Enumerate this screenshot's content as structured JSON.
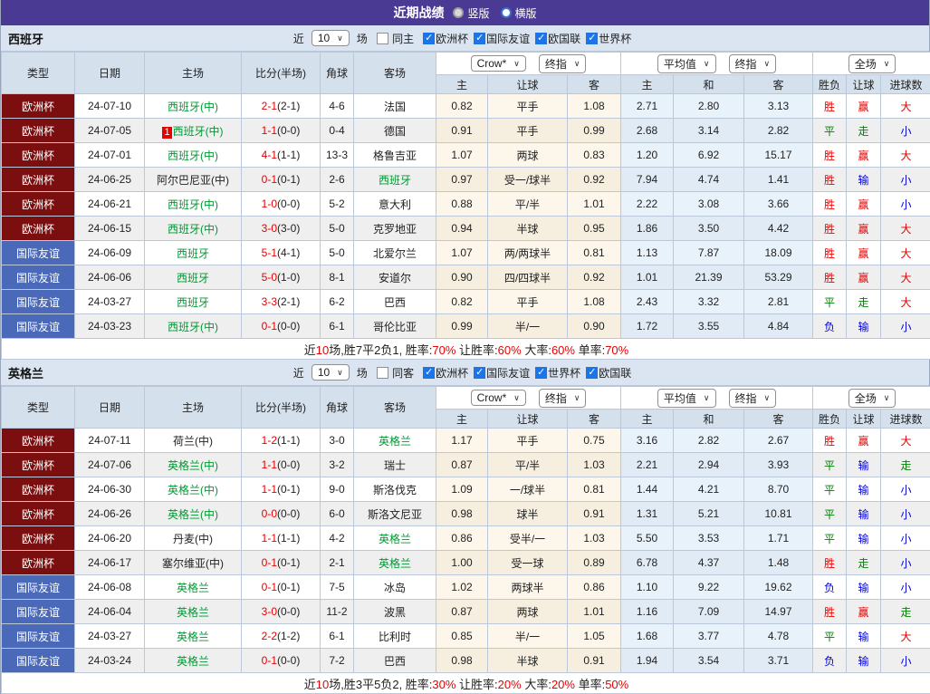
{
  "colors": {
    "topbar": "#4a3a94",
    "cup_type": "#7b0e0e",
    "friendly_type": "#4a69b8",
    "win_red": "#e60000",
    "team_green": "#009933",
    "lose_blue": "#0000dd",
    "header_bg": "#d5e0ed",
    "crow_col_bg": "#fdf6ea",
    "avg_col_bg": "#e8f2fb"
  },
  "topbar": {
    "title": "近期战绩",
    "radios": [
      {
        "label": "竖版",
        "selected": false
      },
      {
        "label": "横版",
        "selected": true
      }
    ]
  },
  "header": {
    "cols": [
      "类型",
      "日期",
      "主场",
      "比分(半场)",
      "角球",
      "客场"
    ],
    "group1": {
      "dd1": "Crow*",
      "dd2": "终指",
      "subs": [
        "主",
        "让球",
        "客"
      ]
    },
    "group2": {
      "dd1": "平均值",
      "dd2": "终指",
      "subs": [
        "主",
        "和",
        "客"
      ]
    },
    "group3": {
      "dd1": "全场",
      "subs": [
        "胜负",
        "让球",
        "进球数"
      ]
    }
  },
  "sections": [
    {
      "team": "西班牙",
      "filter": {
        "near": "近",
        "count": "10",
        "unit": "场",
        "same_label": "同主",
        "same_checked": false,
        "comps": [
          {
            "label": "欧洲杯",
            "checked": true
          },
          {
            "label": "国际友谊",
            "checked": true
          },
          {
            "label": "欧国联",
            "checked": true
          },
          {
            "label": "世界杯",
            "checked": true
          }
        ]
      },
      "rows": [
        {
          "type": "欧洲杯",
          "type_cls": "cup",
          "date": "24-07-10",
          "badge": "",
          "home": "西班牙(中)",
          "home_cls": "g",
          "score": "2-1",
          "half": "(2-1)",
          "corner": "4-6",
          "away": "法国",
          "away_cls": "k",
          "odds1": [
            "0.82",
            "平手",
            "1.08"
          ],
          "odds2": [
            "2.71",
            "2.80",
            "3.13"
          ],
          "res": [
            {
              "t": "胜",
              "c": "r"
            },
            {
              "t": "赢",
              "c": "r"
            },
            {
              "t": "大",
              "c": "r"
            }
          ]
        },
        {
          "type": "欧洲杯",
          "type_cls": "cup",
          "date": "24-07-05",
          "badge": "1",
          "home": "西班牙(中)",
          "home_cls": "g",
          "score": "1-1",
          "half": "(0-0)",
          "corner": "0-4",
          "away": "德国",
          "away_cls": "k",
          "odds1": [
            "0.91",
            "平手",
            "0.99"
          ],
          "odds2": [
            "2.68",
            "3.14",
            "2.82"
          ],
          "res": [
            {
              "t": "平",
              "c": "g"
            },
            {
              "t": "走",
              "c": "g"
            },
            {
              "t": "小",
              "c": "b"
            }
          ]
        },
        {
          "type": "欧洲杯",
          "type_cls": "cup",
          "date": "24-07-01",
          "badge": "",
          "home": "西班牙(中)",
          "home_cls": "g",
          "score": "4-1",
          "half": "(1-1)",
          "corner": "13-3",
          "away": "格鲁吉亚",
          "away_cls": "k",
          "odds1": [
            "1.07",
            "两球",
            "0.83"
          ],
          "odds2": [
            "1.20",
            "6.92",
            "15.17"
          ],
          "res": [
            {
              "t": "胜",
              "c": "r"
            },
            {
              "t": "赢",
              "c": "r"
            },
            {
              "t": "大",
              "c": "r"
            }
          ]
        },
        {
          "type": "欧洲杯",
          "type_cls": "cup",
          "date": "24-06-25",
          "badge": "",
          "home": "阿尔巴尼亚(中)",
          "home_cls": "k",
          "score": "0-1",
          "half": "(0-1)",
          "corner": "2-6",
          "away": "西班牙",
          "away_cls": "g",
          "odds1": [
            "0.97",
            "受一/球半",
            "0.92"
          ],
          "odds2": [
            "7.94",
            "4.74",
            "1.41"
          ],
          "res": [
            {
              "t": "胜",
              "c": "r"
            },
            {
              "t": "输",
              "c": "b"
            },
            {
              "t": "小",
              "c": "b"
            }
          ]
        },
        {
          "type": "欧洲杯",
          "type_cls": "cup",
          "date": "24-06-21",
          "badge": "",
          "home": "西班牙(中)",
          "home_cls": "g",
          "score": "1-0",
          "half": "(0-0)",
          "corner": "5-2",
          "away": "意大利",
          "away_cls": "k",
          "odds1": [
            "0.88",
            "平/半",
            "1.01"
          ],
          "odds2": [
            "2.22",
            "3.08",
            "3.66"
          ],
          "res": [
            {
              "t": "胜",
              "c": "r"
            },
            {
              "t": "赢",
              "c": "r"
            },
            {
              "t": "小",
              "c": "b"
            }
          ]
        },
        {
          "type": "欧洲杯",
          "type_cls": "cup",
          "date": "24-06-15",
          "badge": "",
          "home": "西班牙(中)",
          "home_cls": "g",
          "score": "3-0",
          "half": "(3-0)",
          "corner": "5-0",
          "away": "克罗地亚",
          "away_cls": "k",
          "odds1": [
            "0.94",
            "半球",
            "0.95"
          ],
          "odds2": [
            "1.86",
            "3.50",
            "4.42"
          ],
          "res": [
            {
              "t": "胜",
              "c": "r"
            },
            {
              "t": "赢",
              "c": "r"
            },
            {
              "t": "大",
              "c": "r"
            }
          ]
        },
        {
          "type": "国际友谊",
          "type_cls": "friendly",
          "date": "24-06-09",
          "badge": "",
          "home": "西班牙",
          "home_cls": "g",
          "score": "5-1",
          "half": "(4-1)",
          "corner": "5-0",
          "away": "北爱尔兰",
          "away_cls": "k",
          "odds1": [
            "1.07",
            "两/两球半",
            "0.81"
          ],
          "odds2": [
            "1.13",
            "7.87",
            "18.09"
          ],
          "res": [
            {
              "t": "胜",
              "c": "r"
            },
            {
              "t": "赢",
              "c": "r"
            },
            {
              "t": "大",
              "c": "r"
            }
          ]
        },
        {
          "type": "国际友谊",
          "type_cls": "friendly",
          "date": "24-06-06",
          "badge": "",
          "home": "西班牙",
          "home_cls": "g",
          "score": "5-0",
          "half": "(1-0)",
          "corner": "8-1",
          "away": "安道尔",
          "away_cls": "k",
          "odds1": [
            "0.90",
            "四/四球半",
            "0.92"
          ],
          "odds2": [
            "1.01",
            "21.39",
            "53.29"
          ],
          "res": [
            {
              "t": "胜",
              "c": "r"
            },
            {
              "t": "赢",
              "c": "r"
            },
            {
              "t": "大",
              "c": "r"
            }
          ]
        },
        {
          "type": "国际友谊",
          "type_cls": "friendly",
          "date": "24-03-27",
          "badge": "",
          "home": "西班牙",
          "home_cls": "g",
          "score": "3-3",
          "half": "(2-1)",
          "corner": "6-2",
          "away": "巴西",
          "away_cls": "k",
          "odds1": [
            "0.82",
            "平手",
            "1.08"
          ],
          "odds2": [
            "2.43",
            "3.32",
            "2.81"
          ],
          "res": [
            {
              "t": "平",
              "c": "g"
            },
            {
              "t": "走",
              "c": "g"
            },
            {
              "t": "大",
              "c": "r"
            }
          ]
        },
        {
          "type": "国际友谊",
          "type_cls": "friendly",
          "date": "24-03-23",
          "badge": "",
          "home": "西班牙(中)",
          "home_cls": "g",
          "score": "0-1",
          "half": "(0-0)",
          "corner": "6-1",
          "away": "哥伦比亚",
          "away_cls": "k",
          "odds1": [
            "0.99",
            "半/一",
            "0.90"
          ],
          "odds2": [
            "1.72",
            "3.55",
            "4.84"
          ],
          "res": [
            {
              "t": "负",
              "c": "b"
            },
            {
              "t": "输",
              "c": "b"
            },
            {
              "t": "小",
              "c": "b"
            }
          ]
        }
      ],
      "summary": [
        {
          "t": "近",
          "c": "k"
        },
        {
          "t": "10",
          "c": "r"
        },
        {
          "t": "场,胜7平2负1, 胜率:",
          "c": "k"
        },
        {
          "t": "70%",
          "c": "r"
        },
        {
          "t": " 让胜率:",
          "c": "k"
        },
        {
          "t": "60%",
          "c": "r"
        },
        {
          "t": " 大率:",
          "c": "k"
        },
        {
          "t": "60%",
          "c": "r"
        },
        {
          "t": " 单率:",
          "c": "k"
        },
        {
          "t": "70%",
          "c": "r"
        }
      ]
    },
    {
      "team": "英格兰",
      "filter": {
        "near": "近",
        "count": "10",
        "unit": "场",
        "same_label": "同客",
        "same_checked": false,
        "comps": [
          {
            "label": "欧洲杯",
            "checked": true
          },
          {
            "label": "国际友谊",
            "checked": true
          },
          {
            "label": "世界杯",
            "checked": true
          },
          {
            "label": "欧国联",
            "checked": true
          }
        ]
      },
      "rows": [
        {
          "type": "欧洲杯",
          "type_cls": "cup",
          "date": "24-07-11",
          "badge": "",
          "home": "荷兰(中)",
          "home_cls": "k",
          "score": "1-2",
          "half": "(1-1)",
          "corner": "3-0",
          "away": "英格兰",
          "away_cls": "g",
          "odds1": [
            "1.17",
            "平手",
            "0.75"
          ],
          "odds2": [
            "3.16",
            "2.82",
            "2.67"
          ],
          "res": [
            {
              "t": "胜",
              "c": "r"
            },
            {
              "t": "赢",
              "c": "r"
            },
            {
              "t": "大",
              "c": "r"
            }
          ]
        },
        {
          "type": "欧洲杯",
          "type_cls": "cup",
          "date": "24-07-06",
          "badge": "",
          "home": "英格兰(中)",
          "home_cls": "g",
          "score": "1-1",
          "half": "(0-0)",
          "corner": "3-2",
          "away": "瑞士",
          "away_cls": "k",
          "odds1": [
            "0.87",
            "平/半",
            "1.03"
          ],
          "odds2": [
            "2.21",
            "2.94",
            "3.93"
          ],
          "res": [
            {
              "t": "平",
              "c": "g"
            },
            {
              "t": "输",
              "c": "b"
            },
            {
              "t": "走",
              "c": "g"
            }
          ]
        },
        {
          "type": "欧洲杯",
          "type_cls": "cup",
          "date": "24-06-30",
          "badge": "",
          "home": "英格兰(中)",
          "home_cls": "g",
          "score": "1-1",
          "half": "(0-1)",
          "corner": "9-0",
          "away": "斯洛伐克",
          "away_cls": "k",
          "odds1": [
            "1.09",
            "一/球半",
            "0.81"
          ],
          "odds2": [
            "1.44",
            "4.21",
            "8.70"
          ],
          "res": [
            {
              "t": "平",
              "c": "g"
            },
            {
              "t": "输",
              "c": "b"
            },
            {
              "t": "小",
              "c": "b"
            }
          ]
        },
        {
          "type": "欧洲杯",
          "type_cls": "cup",
          "date": "24-06-26",
          "badge": "",
          "home": "英格兰(中)",
          "home_cls": "g",
          "score": "0-0",
          "half": "(0-0)",
          "corner": "6-0",
          "away": "斯洛文尼亚",
          "away_cls": "k",
          "odds1": [
            "0.98",
            "球半",
            "0.91"
          ],
          "odds2": [
            "1.31",
            "5.21",
            "10.81"
          ],
          "res": [
            {
              "t": "平",
              "c": "g"
            },
            {
              "t": "输",
              "c": "b"
            },
            {
              "t": "小",
              "c": "b"
            }
          ]
        },
        {
          "type": "欧洲杯",
          "type_cls": "cup",
          "date": "24-06-20",
          "badge": "",
          "home": "丹麦(中)",
          "home_cls": "k",
          "score": "1-1",
          "half": "(1-1)",
          "corner": "4-2",
          "away": "英格兰",
          "away_cls": "g",
          "odds1": [
            "0.86",
            "受半/一",
            "1.03"
          ],
          "odds2": [
            "5.50",
            "3.53",
            "1.71"
          ],
          "res": [
            {
              "t": "平",
              "c": "g"
            },
            {
              "t": "输",
              "c": "b"
            },
            {
              "t": "小",
              "c": "b"
            }
          ]
        },
        {
          "type": "欧洲杯",
          "type_cls": "cup",
          "date": "24-06-17",
          "badge": "",
          "home": "塞尔维亚(中)",
          "home_cls": "k",
          "score": "0-1",
          "half": "(0-1)",
          "corner": "2-1",
          "away": "英格兰",
          "away_cls": "g",
          "odds1": [
            "1.00",
            "受一球",
            "0.89"
          ],
          "odds2": [
            "6.78",
            "4.37",
            "1.48"
          ],
          "res": [
            {
              "t": "胜",
              "c": "r"
            },
            {
              "t": "走",
              "c": "g"
            },
            {
              "t": "小",
              "c": "b"
            }
          ]
        },
        {
          "type": "国际友谊",
          "type_cls": "friendly",
          "date": "24-06-08",
          "badge": "",
          "home": "英格兰",
          "home_cls": "g",
          "score": "0-1",
          "half": "(0-1)",
          "corner": "7-5",
          "away": "冰岛",
          "away_cls": "k",
          "odds1": [
            "1.02",
            "两球半",
            "0.86"
          ],
          "odds2": [
            "1.10",
            "9.22",
            "19.62"
          ],
          "res": [
            {
              "t": "负",
              "c": "b"
            },
            {
              "t": "输",
              "c": "b"
            },
            {
              "t": "小",
              "c": "b"
            }
          ]
        },
        {
          "type": "国际友谊",
          "type_cls": "friendly",
          "date": "24-06-04",
          "badge": "",
          "home": "英格兰",
          "home_cls": "g",
          "score": "3-0",
          "half": "(0-0)",
          "corner": "11-2",
          "away": "波黑",
          "away_cls": "k",
          "odds1": [
            "0.87",
            "两球",
            "1.01"
          ],
          "odds2": [
            "1.16",
            "7.09",
            "14.97"
          ],
          "res": [
            {
              "t": "胜",
              "c": "r"
            },
            {
              "t": "赢",
              "c": "r"
            },
            {
              "t": "走",
              "c": "g"
            }
          ]
        },
        {
          "type": "国际友谊",
          "type_cls": "friendly",
          "date": "24-03-27",
          "badge": "",
          "home": "英格兰",
          "home_cls": "g",
          "score": "2-2",
          "half": "(1-2)",
          "corner": "6-1",
          "away": "比利时",
          "away_cls": "k",
          "odds1": [
            "0.85",
            "半/一",
            "1.05"
          ],
          "odds2": [
            "1.68",
            "3.77",
            "4.78"
          ],
          "res": [
            {
              "t": "平",
              "c": "g"
            },
            {
              "t": "输",
              "c": "b"
            },
            {
              "t": "大",
              "c": "r"
            }
          ]
        },
        {
          "type": "国际友谊",
          "type_cls": "friendly",
          "date": "24-03-24",
          "badge": "",
          "home": "英格兰",
          "home_cls": "g",
          "score": "0-1",
          "half": "(0-0)",
          "corner": "7-2",
          "away": "巴西",
          "away_cls": "k",
          "odds1": [
            "0.98",
            "半球",
            "0.91"
          ],
          "odds2": [
            "1.94",
            "3.54",
            "3.71"
          ],
          "res": [
            {
              "t": "负",
              "c": "b"
            },
            {
              "t": "输",
              "c": "b"
            },
            {
              "t": "小",
              "c": "b"
            }
          ]
        }
      ],
      "summary": [
        {
          "t": "近",
          "c": "k"
        },
        {
          "t": "10",
          "c": "r"
        },
        {
          "t": "场,胜3平5负2, 胜率:",
          "c": "k"
        },
        {
          "t": "30%",
          "c": "r"
        },
        {
          "t": " 让胜率:",
          "c": "k"
        },
        {
          "t": "20%",
          "c": "r"
        },
        {
          "t": " 大率:",
          "c": "k"
        },
        {
          "t": "20%",
          "c": "r"
        },
        {
          "t": " 单率:",
          "c": "k"
        },
        {
          "t": "50%",
          "c": "r"
        }
      ]
    }
  ]
}
